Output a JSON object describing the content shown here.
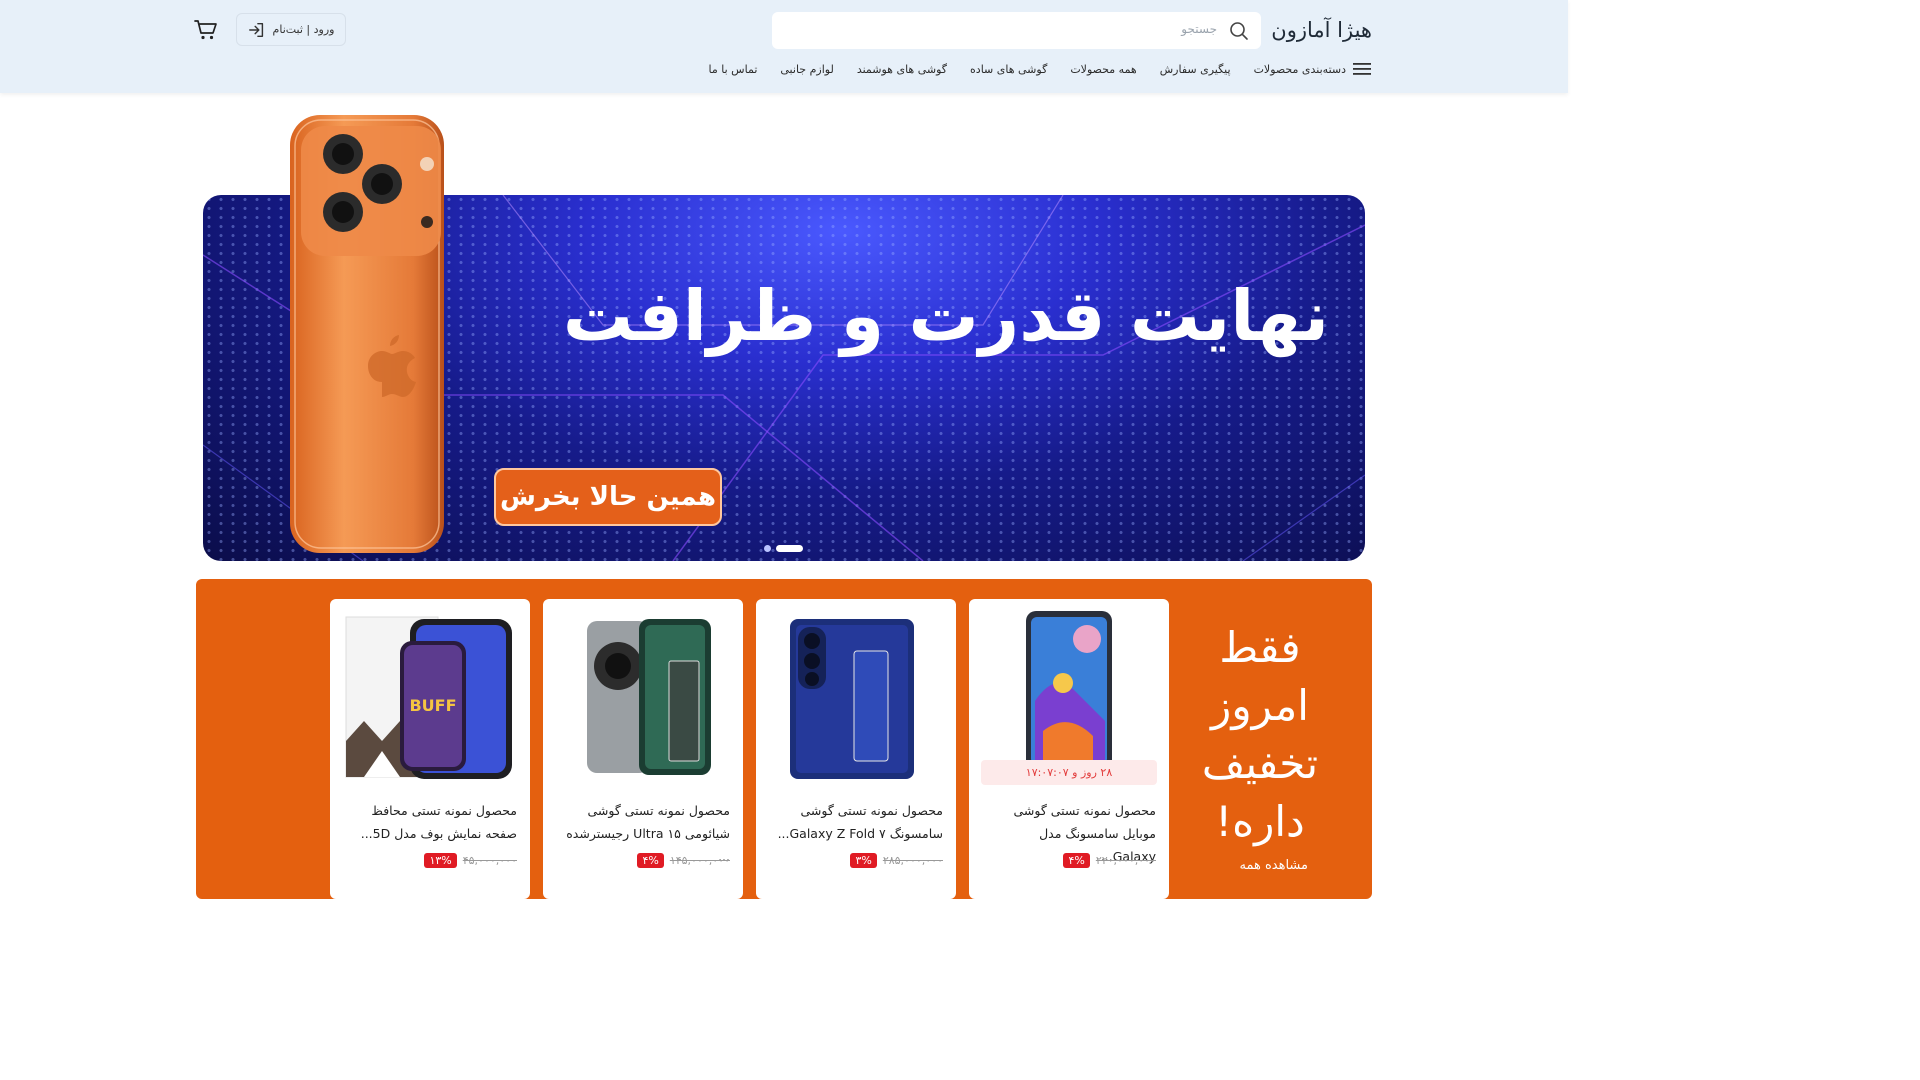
{
  "header": {
    "logo": "هیژا آمازون",
    "search_placeholder": "جستجو",
    "login_label": "ورود | ثبت‌نام",
    "icons": {
      "search": "search-icon",
      "login": "login-arrow-icon",
      "cart": "cart-icon",
      "menu": "hamburger-icon"
    }
  },
  "nav": {
    "items": [
      {
        "label": "دسته‌بندی محصولات"
      },
      {
        "label": "پیگیری سفارش"
      },
      {
        "label": "همه محصولات"
      },
      {
        "label": "گوشی های ساده"
      },
      {
        "label": "گوشی های هوشمند"
      },
      {
        "label": "لوازم جانبی"
      },
      {
        "label": "تماس با ما"
      }
    ]
  },
  "banner": {
    "headline": "نهایت قدرت و ظرافت",
    "cta_label": "همین حالا بخرش",
    "slide_count": 2,
    "active_slide": 1
  },
  "deals": {
    "title": "فقط امروز تخفیف داره!",
    "see_all": "مشاهده همه",
    "colors": {
      "panel": "#e4600f",
      "badge": "#e01b24"
    },
    "products": [
      {
        "name": "محصول نمونه تستی گوشی موبایل سامسونگ مدل Galaxy...",
        "old_price": "۲۲۰,۰۰۰,۰۰۰",
        "discount": "۴%",
        "timer": "۲۸ روز و ۱۷:۰۷:۰۷"
      },
      {
        "name": "محصول نمونه تستی گوشی سامسونگ Galaxy Z Fold ۷...",
        "old_price": "۲۸۵,۰۰۰,۰۰۰",
        "discount": "۳%"
      },
      {
        "name": "محصول نمونه تستی گوشی شیائومی Ultra ۱۵ رجیسترشده ...",
        "old_price": "۱۴۵,۰۰۰,۰۰۰",
        "discount": "۴%"
      },
      {
        "name": "محصول نمونه تستی محافظ صفحه نمایش بوف مدل 5D...",
        "old_price": "۴۵,۰۰۰,۰۰۰",
        "discount": "۱۳%"
      }
    ]
  }
}
